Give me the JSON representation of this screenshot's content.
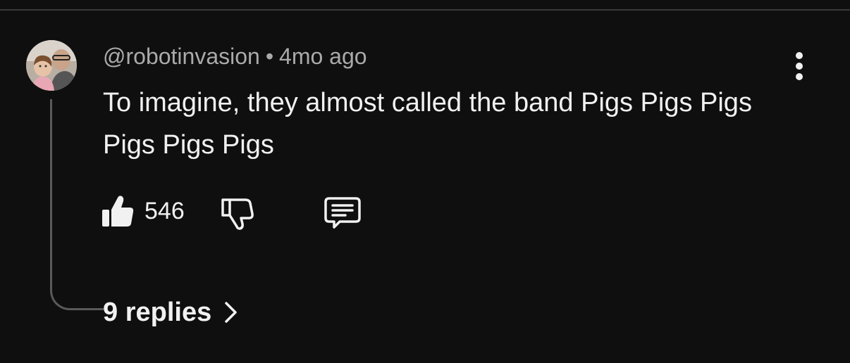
{
  "comment": {
    "author": "@robotinvasion",
    "separator": "•",
    "timestamp": "4mo ago",
    "text": "To imagine, they almost called the band Pigs Pigs Pigs Pigs Pigs Pigs",
    "like_count": "546",
    "replies_label": "9 replies"
  },
  "icons": {
    "avatar": "avatar",
    "menu": "more-vertical-icon",
    "like": "thumbs-up-filled-icon",
    "dislike": "thumbs-down-outline-icon",
    "reply": "comment-bubble-icon",
    "chevron": "chevron-right-icon"
  },
  "colors": {
    "background": "#0f0f0f",
    "primary_text": "#f1f1f1",
    "secondary_text": "#aaaaaa",
    "thread_line": "#5a5a5a"
  }
}
